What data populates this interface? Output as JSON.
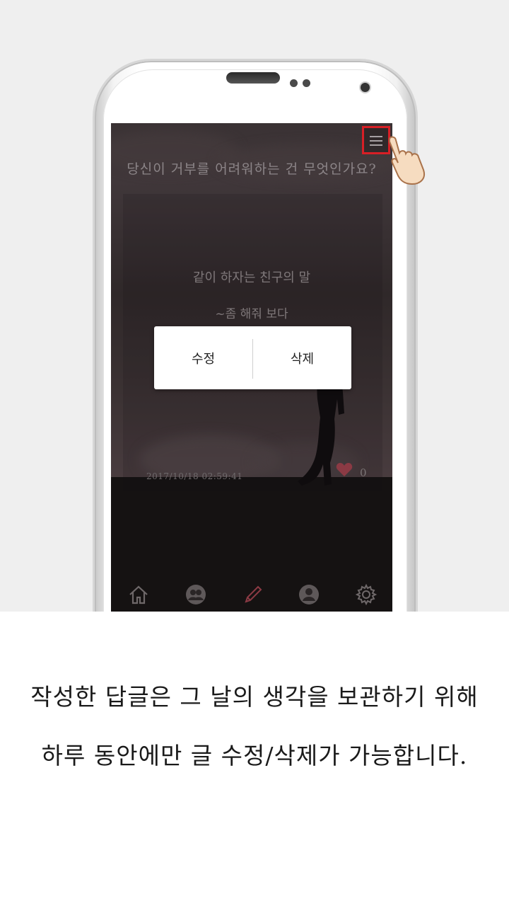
{
  "screen": {
    "question": "당신이 거부를 어려워하는 건 무엇인가요?",
    "answer_line1": "같이 하자는 친구의 말",
    "answer_line2": "~좀 해줘 보다",
    "timestamp": "2017/10/18   02:59:41",
    "like_count": "0",
    "menu_icon": "hamburger-menu-icon",
    "accent_color": "#d71f26",
    "heart_color": "#8b3a44"
  },
  "dialog": {
    "edit_label": "수정",
    "delete_label": "삭제"
  },
  "nav": {
    "items": [
      "home-icon",
      "community-icon",
      "write-icon",
      "profile-icon",
      "settings-icon"
    ]
  },
  "caption": {
    "line1": "작성한 답글은 그 날의 생각을 보관하기 위해",
    "line2": "하루 동안에만 글 수정/삭제가 가능합니다."
  }
}
